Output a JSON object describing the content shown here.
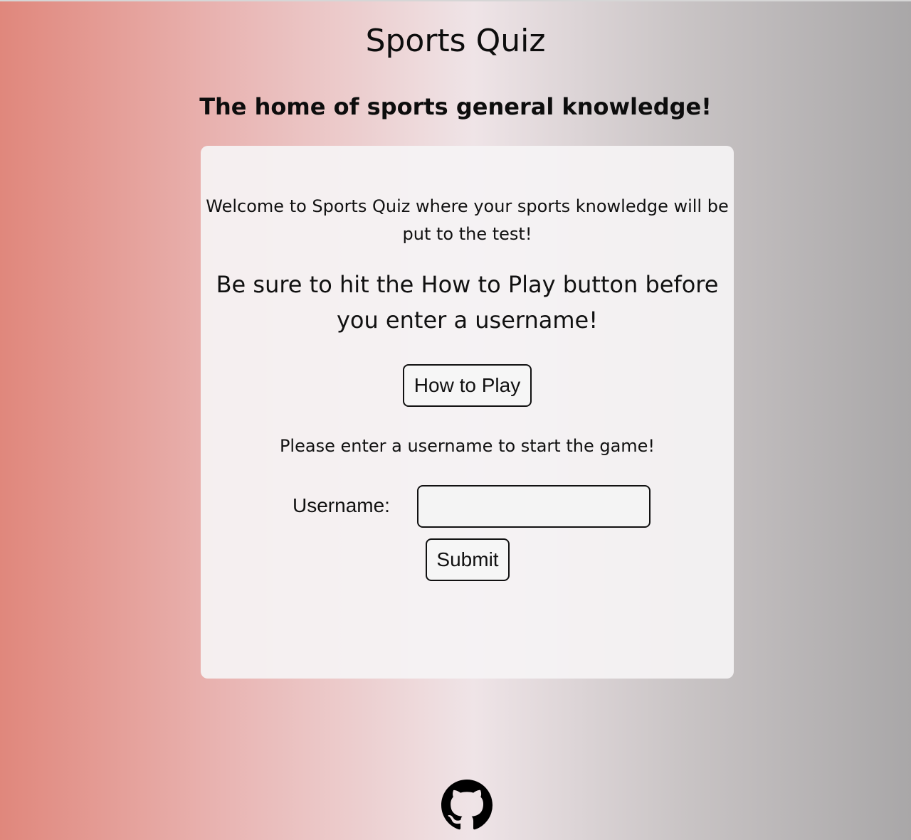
{
  "header": {
    "title": "Sports Quiz",
    "subtitle": "The home of sports general knowledge!"
  },
  "card": {
    "welcome": "Welcome to Sports Quiz where your sports knowledge will be put to the test!",
    "instruction": "Be sure to hit the How to Play button before you enter a username!",
    "how_to_play_label": "How to Play",
    "prompt": "Please enter a username to start the game!",
    "form": {
      "username_label": "Username:",
      "username_value": "",
      "username_placeholder": "",
      "submit_label": "Submit"
    }
  },
  "footer": {
    "icon": "github-icon"
  },
  "colors": {
    "gradient_left": "#e0877c",
    "gradient_mid": "#efe4e7",
    "gradient_right": "#a9a7a8",
    "card_background": "#f5f3f4",
    "text": "#111111"
  }
}
